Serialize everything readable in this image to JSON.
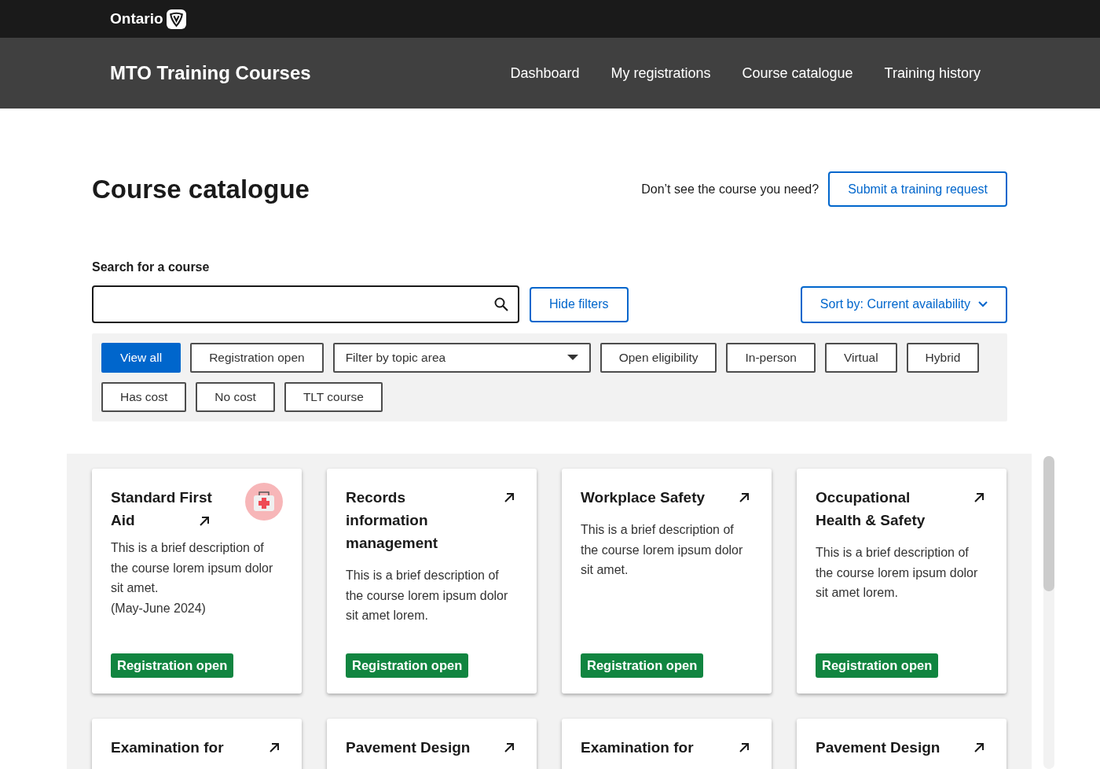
{
  "brand": {
    "name": "Ontario"
  },
  "app_bar": {
    "title": "MTO Training Courses",
    "nav": [
      {
        "label": "Dashboard"
      },
      {
        "label": "My registrations"
      },
      {
        "label": "Course catalogue"
      },
      {
        "label": "Training history"
      }
    ]
  },
  "page": {
    "title": "Course catalogue",
    "prompt": "Don’t see the course you need?",
    "request_button": "Submit a training request"
  },
  "search": {
    "label": "Search for a course",
    "filters_button": "Hide filters",
    "sort": "Sort by: Current availability"
  },
  "filters": [
    {
      "label": "View all",
      "kind": "chip",
      "selected": true
    },
    {
      "label": "Registration open",
      "kind": "chip",
      "selected": false
    },
    {
      "label": "Filter by topic area",
      "kind": "dropdown",
      "selected": false
    },
    {
      "label": "Open eligibility",
      "kind": "chip",
      "selected": false
    },
    {
      "label": "In-person",
      "kind": "chip",
      "selected": false
    },
    {
      "label": "Virtual",
      "kind": "chip",
      "selected": false
    },
    {
      "label": "Hybrid",
      "kind": "chip",
      "selected": false
    },
    {
      "label": "Has cost",
      "kind": "chip",
      "selected": false
    },
    {
      "label": "No cost",
      "kind": "chip",
      "selected": false
    },
    {
      "label": "TLT course",
      "kind": "chip",
      "selected": false
    }
  ],
  "courses": [
    {
      "title": "Standard First Aid",
      "kind": "illustrated",
      "description": "This is a brief description of the course lorem ipsum dolor sit amet.",
      "note": "(May-June 2024)",
      "status": "Registration open"
    },
    {
      "title": "Records information management",
      "description": "This is a brief description of the course lorem ipsum dolor sit amet lorem.",
      "status": "Registration open"
    },
    {
      "title": "Workplace Safety",
      "description": "This is a brief description of the course lorem ipsum dolor sit amet.",
      "status": "Registration open"
    },
    {
      "title": "Occupational Health & Safety",
      "description": "This is a brief description of the course lorem ipsum dolor sit amet lorem.",
      "status": "Registration open"
    },
    {
      "title": "Examination for"
    },
    {
      "title": "Pavement Design"
    },
    {
      "title": "Examination for"
    },
    {
      "title": "Pavement Design"
    }
  ]
}
